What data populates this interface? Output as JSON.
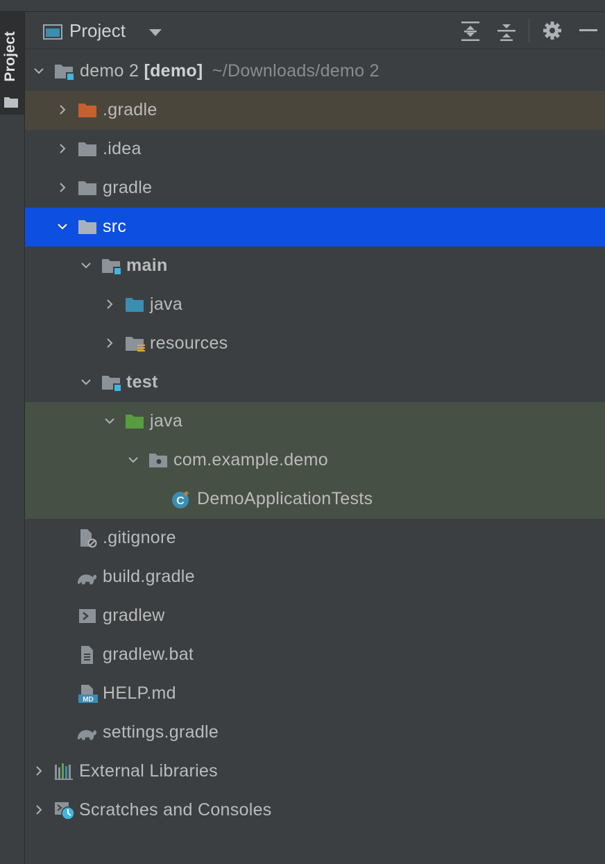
{
  "side_tab": {
    "label": "Project"
  },
  "header": {
    "title": "Project",
    "tools": [
      "expand-all-icon",
      "collapse-all-icon",
      "gear-icon",
      "minimize-icon"
    ]
  },
  "tree": {
    "root": {
      "name": "demo 2",
      "module": "[demo]",
      "path": "~/Downloads/demo 2"
    },
    "items": [
      {
        "label": ".gradle",
        "icon": "folder-excluded-icon"
      },
      {
        "label": ".idea",
        "icon": "folder-icon"
      },
      {
        "label": "gradle",
        "icon": "folder-icon"
      },
      {
        "label": "src",
        "icon": "folder-icon"
      },
      {
        "label": "main",
        "icon": "module-folder-icon"
      },
      {
        "label": "java",
        "icon": "source-folder-icon"
      },
      {
        "label": "resources",
        "icon": "resources-folder-icon"
      },
      {
        "label": "test",
        "icon": "module-folder-icon"
      },
      {
        "label": "java",
        "icon": "test-folder-icon"
      },
      {
        "label": "com.example.demo",
        "icon": "package-icon"
      },
      {
        "label": "DemoApplicationTests",
        "icon": "class-icon"
      },
      {
        "label": ".gitignore",
        "icon": "ignore-file-icon"
      },
      {
        "label": "build.gradle",
        "icon": "gradle-icon"
      },
      {
        "label": "gradlew",
        "icon": "shell-script-icon"
      },
      {
        "label": "gradlew.bat",
        "icon": "text-file-icon"
      },
      {
        "label": "HELP.md",
        "icon": "markdown-icon"
      },
      {
        "label": "settings.gradle",
        "icon": "gradle-icon"
      },
      {
        "label": "External Libraries",
        "icon": "libraries-icon"
      },
      {
        "label": "Scratches and Consoles",
        "icon": "scratches-icon"
      }
    ]
  },
  "colors": {
    "background": "#3c3f41",
    "selection": "#0d4fe0",
    "excluded_row": "#4a463c",
    "test_row": "#475045",
    "folder": "#8c9398",
    "excluded_folder": "#c75f2f",
    "source_folder": "#3b8db2",
    "test_folder": "#579c3e",
    "module_badge": "#40b6e0"
  }
}
